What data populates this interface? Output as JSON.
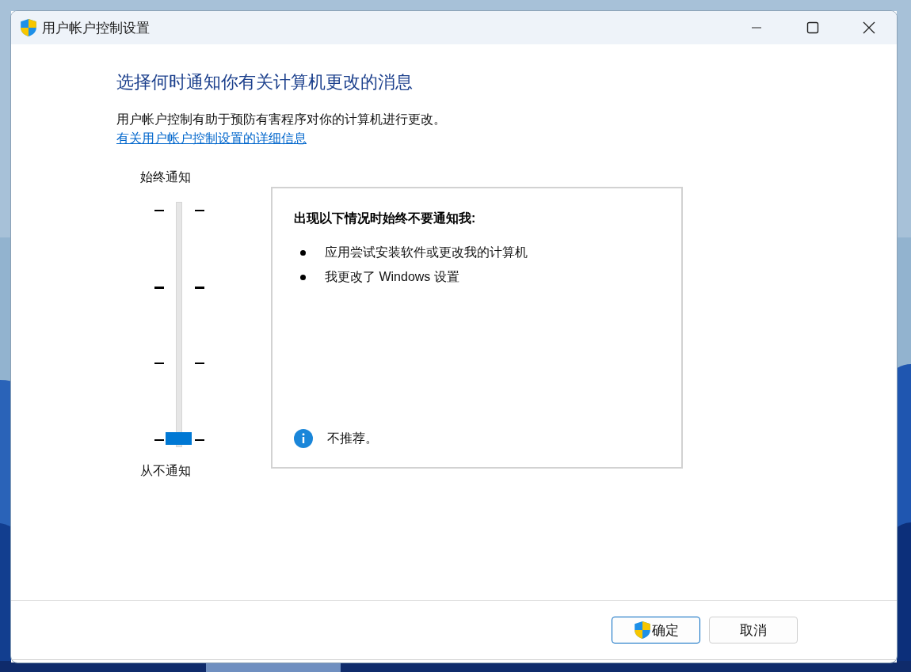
{
  "window": {
    "title": "用户帐户控制设置"
  },
  "heading": "选择何时通知你有关计算机更改的消息",
  "description": "用户帐户控制有助于预防有害程序对你的计算机进行更改。",
  "link": "有关用户帐户控制设置的详细信息",
  "slider": {
    "top_label": "始终通知",
    "bottom_label": "从不通知",
    "level": 0
  },
  "info": {
    "title": "出现以下情况时始终不要通知我:",
    "bullets": [
      "应用尝试安装软件或更改我的计算机",
      "我更改了 Windows 设置"
    ],
    "note": "不推荐。"
  },
  "buttons": [
    {
      "label": "确定",
      "shield": true
    },
    {
      "label": "取消",
      "shield": false
    }
  ]
}
